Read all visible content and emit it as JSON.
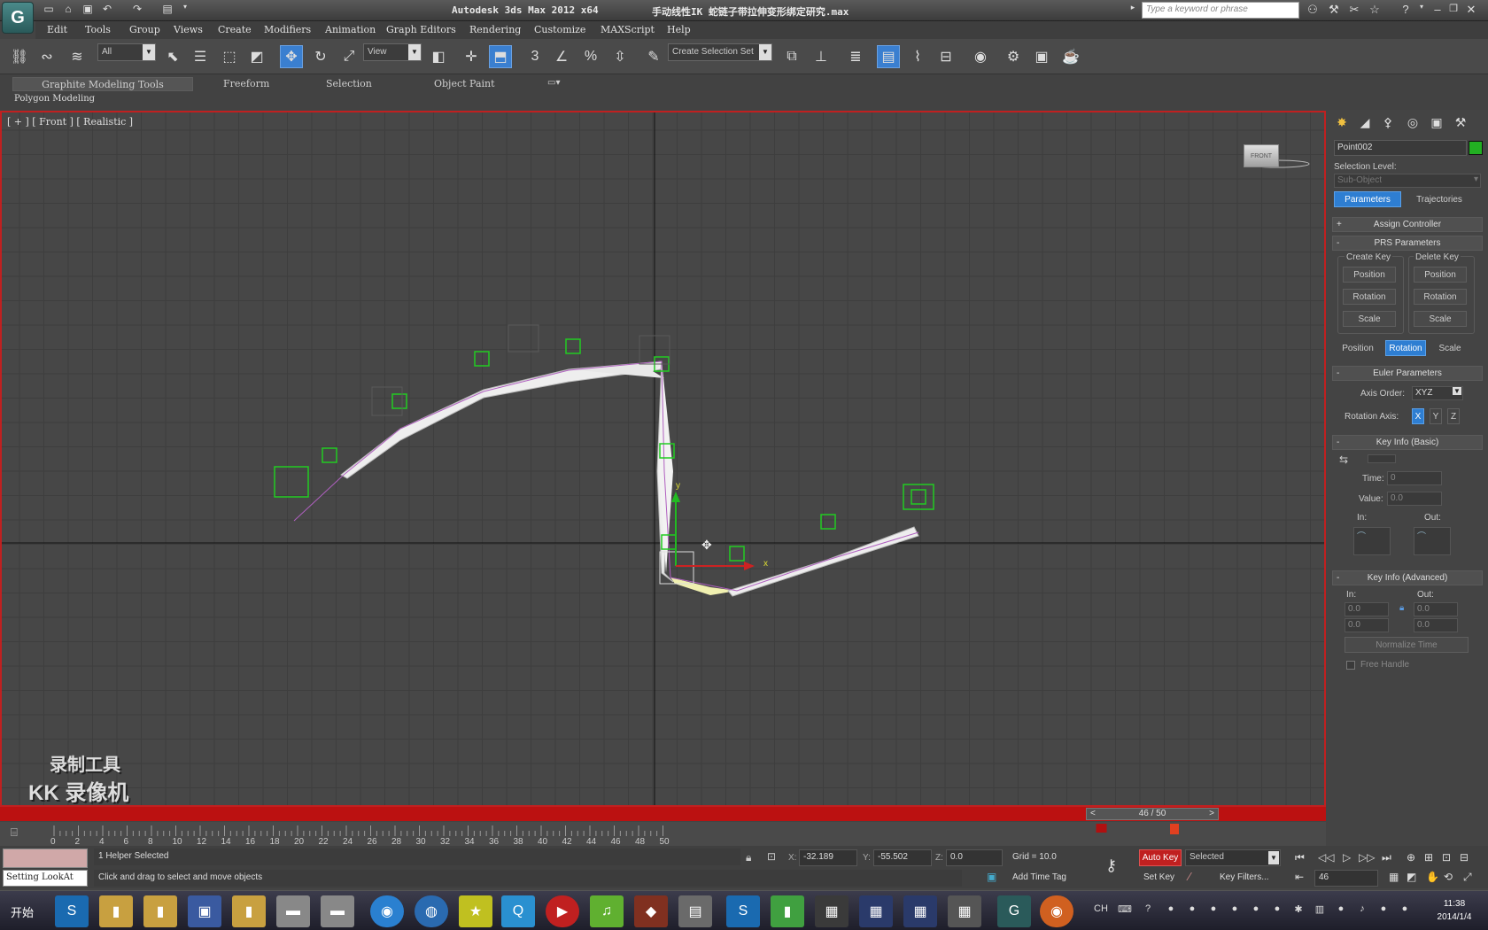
{
  "app": {
    "title": "Autodesk 3ds Max   2012 x64",
    "file": "手动线性IK 蛇链子带拉伸变形绑定研究.max"
  },
  "search": {
    "placeholder": "Type a keyword or phrase"
  },
  "menus": [
    "Edit",
    "Tools",
    "Group",
    "Views",
    "Create",
    "Modifiers",
    "Animation",
    "Graph Editors",
    "Rendering",
    "Customize",
    "MAXScript",
    "Help"
  ],
  "toolbar": {
    "selection_filter": "All",
    "ref_coord": "View",
    "snap_num": "3",
    "selection_set": "Create Selection Set"
  },
  "ribbon": {
    "tabs": [
      "Graphite Modeling Tools",
      "Freeform",
      "Selection",
      "Object Paint"
    ],
    "subtitle": "Polygon Modeling"
  },
  "viewport": {
    "label": "[ + ] [ Front ] [ Realistic ]",
    "viewcube_label": "FRONT",
    "gizmo_y": "y",
    "gizmo_x": "x"
  },
  "watermark": {
    "line1": "录制工具",
    "line2": "KK 录像机"
  },
  "command_panel": {
    "object_name": "Point002",
    "object_color": "#22b022",
    "selection_level": "Selection Level:",
    "sub_object": "Sub-Object",
    "tabs": {
      "parameters": "Parameters",
      "trajectories": "Trajectories"
    },
    "assign_controller": "Assign Controller",
    "prs": {
      "title": "PRS Parameters",
      "create_key": "Create Key",
      "delete_key": "Delete Key",
      "position": "Position",
      "rotation": "Rotation",
      "scale": "Scale"
    },
    "euler": {
      "title": "Euler Parameters",
      "axis_order_label": "Axis Order:",
      "axis_order": "XYZ",
      "rotation_axis_label": "Rotation Axis:",
      "x": "X",
      "y": "Y",
      "z": "Z"
    },
    "key_basic": {
      "title": "Key Info (Basic)",
      "time_label": "Time:",
      "time": "0",
      "value_label": "Value:",
      "value": "0.0",
      "in": "In:",
      "out": "Out:"
    },
    "key_adv": {
      "title": "Key Info (Advanced)",
      "in": "In:",
      "out": "Out:",
      "in1": "0.0",
      "in2": "0.0",
      "out1": "0.0",
      "out2": "0.0",
      "normalize": "Normalize Time",
      "free_handle": "Free Handle"
    }
  },
  "timeline": {
    "frame_counter": "46 / 50",
    "prev": "<",
    "next": ">",
    "ticks": [
      "0",
      "2",
      "4",
      "6",
      "8",
      "10",
      "12",
      "14",
      "16",
      "18",
      "20",
      "22",
      "24",
      "26",
      "28",
      "30",
      "32",
      "34",
      "36",
      "38",
      "40",
      "42",
      "44",
      "46",
      "48",
      "50"
    ],
    "current_frame": 46
  },
  "status": {
    "selected": "1 Helper Selected",
    "prompt": "Click and drag to select and move objects",
    "listener": "Setting LookAt",
    "x_label": "X:",
    "x": "-32.189",
    "y_label": "Y:",
    "y": "-55.502",
    "z_label": "Z:",
    "z": "0.0",
    "grid": "Grid = 10.0",
    "add_time_tag": "Add Time Tag",
    "auto_key": "Auto Key",
    "selected_mode": "Selected",
    "set_key": "Set Key",
    "key_filters": "Key Filters...",
    "frame": "46"
  },
  "taskbar": {
    "start": "开始",
    "lang": "CH",
    "time": "11:38",
    "date": "2014/1/4"
  }
}
